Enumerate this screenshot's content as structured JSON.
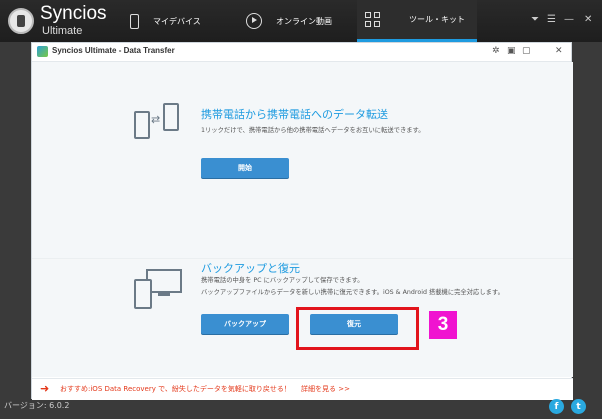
{
  "app": {
    "name": "Syncios",
    "edition": "Ultimate"
  },
  "nav": {
    "tabs": [
      {
        "label": "マイデバイス",
        "icon": "phone-icon"
      },
      {
        "label": "オンライン動画",
        "icon": "play-circle-icon"
      },
      {
        "label": "ツール・キット",
        "icon": "tools-grid-icon"
      }
    ],
    "active_tab": 2
  },
  "window_controls": {
    "menu": "⏷",
    "settings": "☰",
    "minimize": "—",
    "close": "✕"
  },
  "dialog": {
    "title": "Syncios Ultimate - Data Transfer",
    "controls": {
      "gear": "✲",
      "save": "▣",
      "minimize": "▢",
      "close": "✕"
    },
    "transfer": {
      "title": "携帯電話から携帯電話へのデータ転送",
      "description": "1リックだけで、携帯電話から他の携帯電話へデータをお互いに転送できます。",
      "start_button": "開始"
    },
    "backup": {
      "title": "バックアップと復元",
      "description_1": "携帯電話の中身を PC にバックアップして保存できます。",
      "description_2": "バックアップファイルからデータを新しい携帯に復元できます。iOS & Android 搭載機に完全対応します。",
      "backup_button": "バックアップ",
      "restore_button": "復元"
    },
    "promo": {
      "icon": "➜",
      "text": "おすすめ:iOS Data Recovery で、紛失したデータを気軽に取り戻せる！",
      "link": "詳細を見る >>"
    }
  },
  "step_badge": "3",
  "version": "バージョン: 6.0.2",
  "social": {
    "facebook": "f",
    "twitter": "t"
  },
  "colors": {
    "accent": "#1e9be0",
    "button": "#3a8fd1",
    "highlight": "#e2141c",
    "badge": "#f013d0",
    "promo": "#e4391b"
  }
}
